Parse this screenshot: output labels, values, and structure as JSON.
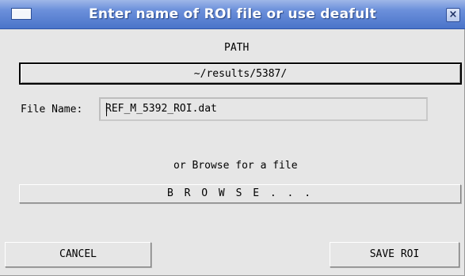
{
  "window": {
    "title": "Enter name of ROI file or use deafult",
    "close_glyph": "×"
  },
  "path": {
    "label": "PATH",
    "value": "~/results/5387/"
  },
  "file": {
    "label": "File Name:",
    "value": "REF_M_5392_ROI.dat"
  },
  "browse": {
    "label": "or Browse for a file",
    "button_label": "B R O W S E . . ."
  },
  "actions": {
    "cancel_label": "CANCEL",
    "save_label": "SAVE ROI"
  }
}
